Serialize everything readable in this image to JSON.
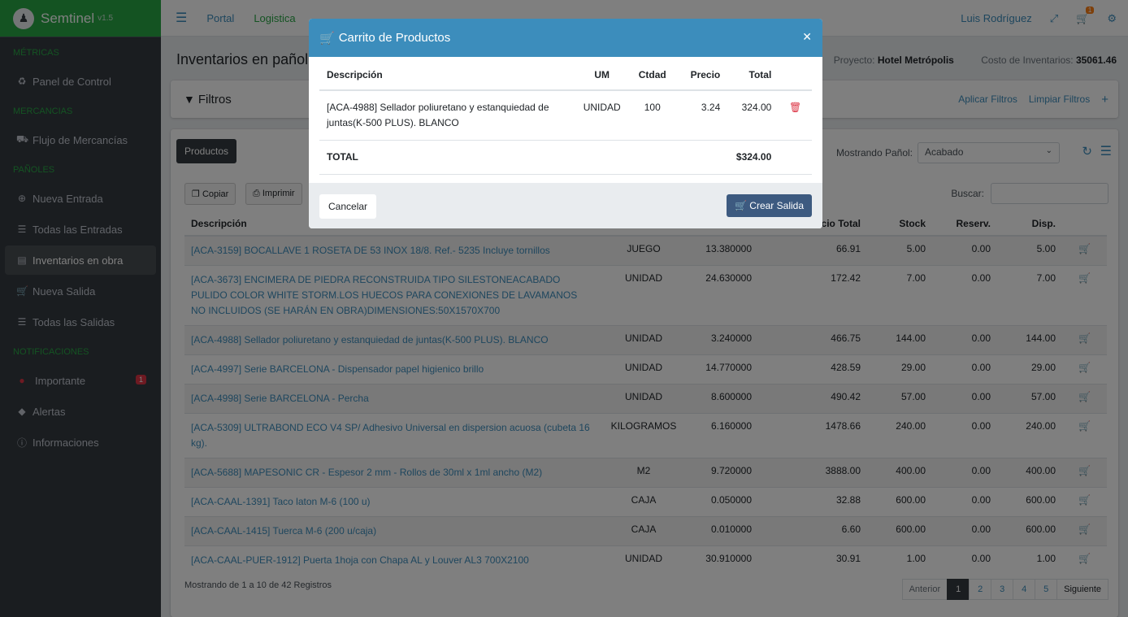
{
  "brand": {
    "name": "Semtinel",
    "version": "v1.5"
  },
  "sidebar": {
    "sections": [
      {
        "title": "MÉTRICAS",
        "items": [
          {
            "label": "Panel de Control",
            "icon": "dashboard-icon"
          }
        ]
      },
      {
        "title": "MERCANCIAS",
        "items": [
          {
            "label": "Flujo de Mercancías",
            "icon": "truck-icon"
          }
        ]
      },
      {
        "title": "PAÑOLES",
        "items": [
          {
            "label": "Nueva Entrada",
            "icon": "plus-circle-icon"
          },
          {
            "label": "Todas las Entradas",
            "icon": "list-icon"
          },
          {
            "label": "Inventarios en obra",
            "icon": "inventory-icon"
          },
          {
            "label": "Nueva Salida",
            "icon": "cart-icon"
          },
          {
            "label": "Todas las Salidas",
            "icon": "list-icon"
          }
        ]
      },
      {
        "title": "NOTIFICACIONES",
        "items": [
          {
            "label": "Importante",
            "icon": "alert-circle-icon",
            "badge": "1"
          },
          {
            "label": "Alertas",
            "icon": "warning-icon"
          },
          {
            "label": "Informaciones",
            "icon": "info-icon"
          }
        ]
      }
    ]
  },
  "topbar": {
    "links": [
      "Portal",
      "Logistica"
    ],
    "user": "Luis Rodríguez",
    "cart_badge": "1"
  },
  "page": {
    "title": "Inventarios en pañol",
    "project_label": "Proyecto:",
    "project": "Hotel Metrópolis",
    "cost_label": "Costo de Inventarios:",
    "cost": "35061.46",
    "filters_title": "Filtros",
    "apply_filters": "Aplicar Filtros",
    "clear_filters": "Limpiar Filtros",
    "tab": "Productos",
    "copy": "Copiar",
    "print": "Imprimir",
    "panol_label": "Mostrando Pañol:",
    "panol_value": "Acabado",
    "search_label": "Buscar:",
    "footer": "Mostrando de 1 a 10 de 42 Registros",
    "pager": {
      "prev": "Anterior",
      "pages": [
        "1",
        "2",
        "3",
        "4",
        "5"
      ],
      "next": "Siguiente"
    }
  },
  "table": {
    "headers": [
      "Descripción",
      "",
      "",
      "cio Total",
      "Stock",
      "Reserv.",
      "Disp.",
      ""
    ],
    "rows": [
      [
        "[ACA-3159] BOCALLAVE 1 ROSETA DE 53 INOX 18/8. Ref.- 5235 Incluye tornillos",
        "JUEGO",
        "13.380000",
        "66.91",
        "5.00",
        "0.00",
        "5.00"
      ],
      [
        "[ACA-3673] ENCIMERA DE PIEDRA RECONSTRUIDA TIPO SILESTONEACABADO PULIDO COLOR WHITE STORM.LOS HUECOS PARA CONEXIONES DE LAVAMANOS NO INCLUIDOS (SE HARÁN EN OBRA)DIMENSIONES:50X1570X700",
        "UNIDAD",
        "24.630000",
        "172.42",
        "7.00",
        "0.00",
        "7.00"
      ],
      [
        "[ACA-4988] Sellador poliuretano y estanquiedad de juntas(K-500 PLUS). BLANCO",
        "UNIDAD",
        "3.240000",
        "466.75",
        "144.00",
        "0.00",
        "144.00"
      ],
      [
        "[ACA-4997] Serie BARCELONA - Dispensador papel higienico brillo",
        "UNIDAD",
        "14.770000",
        "428.59",
        "29.00",
        "0.00",
        "29.00"
      ],
      [
        "[ACA-4998] Serie BARCELONA - Percha",
        "UNIDAD",
        "8.600000",
        "490.42",
        "57.00",
        "0.00",
        "57.00"
      ],
      [
        "[ACA-5309] ULTRABOND ECO V4 SP/ Adhesivo Universal en dispersion acuosa (cubeta 16 kg).",
        "KILOGRAMOS",
        "6.160000",
        "1478.66",
        "240.00",
        "0.00",
        "240.00"
      ],
      [
        "[ACA-5688] MAPESONIC CR - Espesor 2 mm - Rollos de 30ml x 1ml ancho (M2)",
        "M2",
        "9.720000",
        "3888.00",
        "400.00",
        "0.00",
        "400.00"
      ],
      [
        "[ACA-CAAL-1391] Taco laton M-6 (100 u)",
        "CAJA",
        "0.050000",
        "32.88",
        "600.00",
        "0.00",
        "600.00"
      ],
      [
        "[ACA-CAAL-1415] Tuerca M-6 (200 u/caja)",
        "CAJA",
        "0.010000",
        "6.60",
        "600.00",
        "0.00",
        "600.00"
      ],
      [
        "[ACA-CAAL-PUER-1912] Puerta 1hoja con Chapa AL y Louver AL3 700X2100",
        "UNIDAD",
        "30.910000",
        "30.91",
        "1.00",
        "0.00",
        "1.00"
      ]
    ]
  },
  "modal": {
    "title": "Carrito de Productos",
    "headers": [
      "Descripción",
      "UM",
      "Ctdad",
      "Precio",
      "Total"
    ],
    "item": {
      "description": "[ACA-4988] Sellador poliuretano y estanquiedad de juntas(K-500 PLUS). BLANCO",
      "um": "UNIDAD",
      "qty": "100",
      "price": "3.24",
      "total": "324.00"
    },
    "total_label": "TOTAL",
    "total_value": "$324.00",
    "cancel": "Cancelar",
    "create": "Crear Salida"
  }
}
